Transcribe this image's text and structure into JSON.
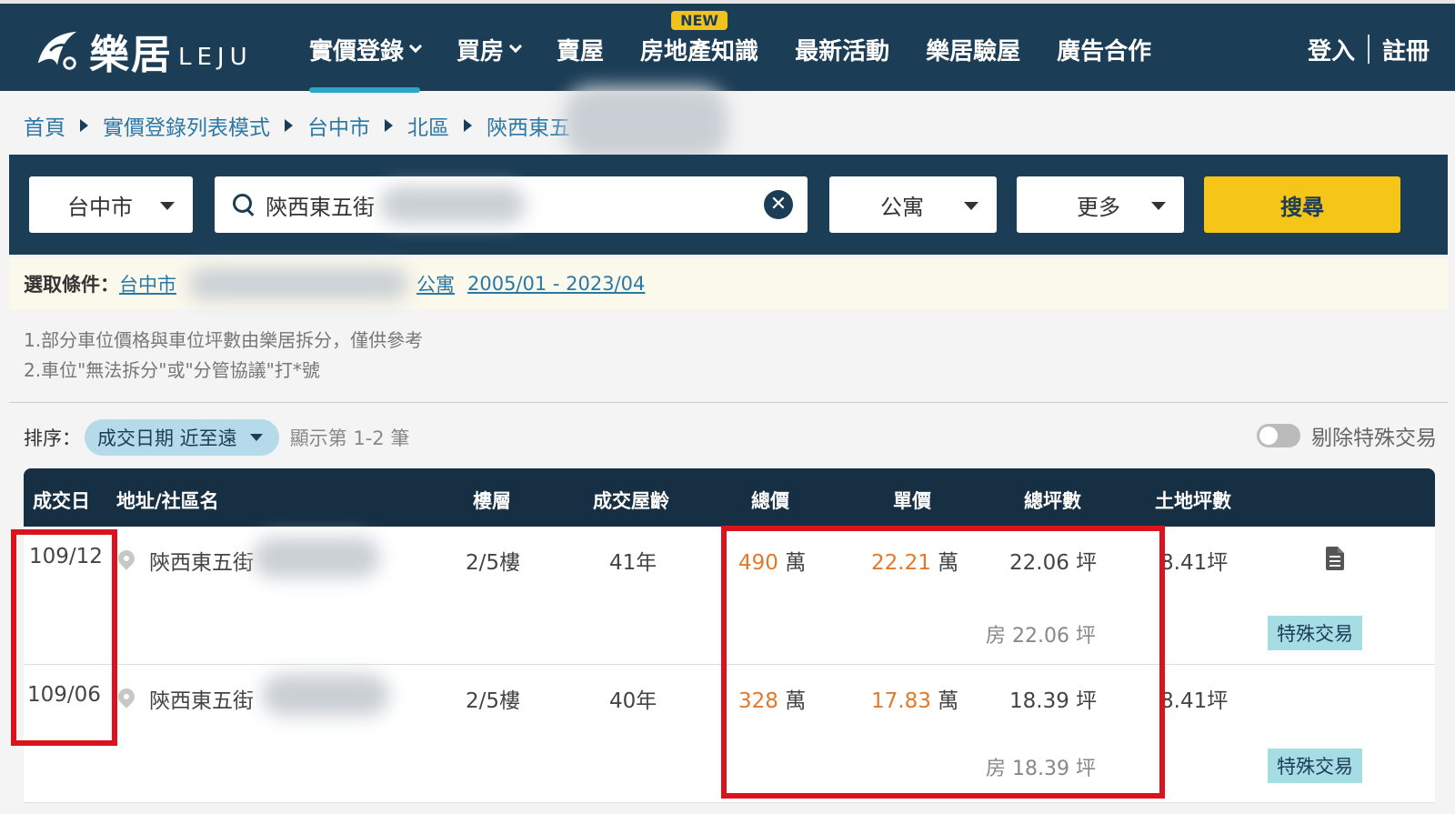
{
  "header": {
    "logo_text": "樂居",
    "logo_sub": "LEJU",
    "nav": [
      {
        "label": "實價登錄",
        "dropdown": true,
        "active": true
      },
      {
        "label": "買房",
        "dropdown": true
      },
      {
        "label": "賣屋"
      },
      {
        "label": "房地產知識",
        "badge": "NEW"
      },
      {
        "label": "最新活動"
      },
      {
        "label": "樂居驗屋"
      },
      {
        "label": "廣告合作"
      }
    ],
    "login": "登入",
    "register": "註冊"
  },
  "breadcrumb": [
    "首頁",
    "實價登錄列表模式",
    "台中市",
    "北區",
    "陝西東五"
  ],
  "search": {
    "city": "台中市",
    "query": "陝西東五街",
    "type": "公寓",
    "more": "更多",
    "button": "搜尋"
  },
  "selected": {
    "label": "選取條件：",
    "city": "台中市",
    "type": "公寓",
    "date_range": "2005/01 - 2023/04"
  },
  "notes": [
    "1.部分車位價格與車位坪數由樂居拆分，僅供參考",
    "2.車位\"無法拆分\"或\"分管協議\"打*號"
  ],
  "sort": {
    "label": "排序：",
    "value": "成交日期 近至遠",
    "count": "顯示第 1-2 筆",
    "exclude_special": "剔除特殊交易"
  },
  "table": {
    "headers": [
      "成交日",
      "地址/社區名",
      "樓層",
      "成交屋齡",
      "總價",
      "單價",
      "總坪數",
      "土地坪數"
    ],
    "rows": [
      {
        "date": "109/12",
        "address": "陝西東五街",
        "floor": "2/5樓",
        "age": "41年",
        "total": "490",
        "total_unit": "萬",
        "unit_price": "22.21",
        "unit_price_unit": "萬",
        "area": "22.06 坪",
        "land": "8.41坪",
        "sub_area": "房 22.06 坪",
        "tag": "特殊交易"
      },
      {
        "date": "109/06",
        "address": "陝西東五街",
        "floor": "2/5樓",
        "age": "40年",
        "total": "328",
        "total_unit": "萬",
        "unit_price": "17.83",
        "unit_price_unit": "萬",
        "area": "18.39 坪",
        "land": "8.41坪",
        "sub_area": "房 18.39 坪",
        "tag": "特殊交易"
      }
    ]
  },
  "colors": {
    "navy": "#1c3d56",
    "accent_yellow": "#f5c518",
    "price_orange": "#e2792a",
    "highlight_red": "#d9141c"
  }
}
